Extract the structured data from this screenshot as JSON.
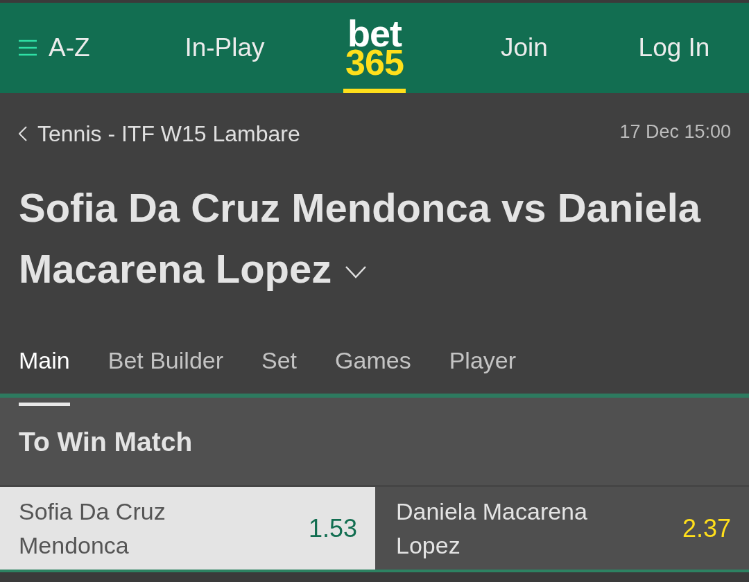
{
  "header": {
    "nav": [
      {
        "kind": "menu",
        "label": "A-Z",
        "selected": false
      },
      {
        "kind": "link",
        "label": "In-Play",
        "selected": false
      },
      {
        "kind": "logo",
        "line_1": "bet",
        "line_2": "365",
        "selected": true
      },
      {
        "kind": "link",
        "label": "Join",
        "selected": false
      },
      {
        "kind": "link",
        "label": "Log In",
        "selected": false
      }
    ]
  },
  "event": {
    "breadcrumb": "Tennis - ITF W15 Lambare",
    "start_time": "17 Dec 15:00",
    "title": "Sofia Da Cruz Mendonca vs Daniela Macarena Lopez"
  },
  "tabs": [
    {
      "label": "Main",
      "selected": true
    },
    {
      "label": "Bet Builder",
      "selected": false
    },
    {
      "label": "Set",
      "selected": false
    },
    {
      "label": "Games",
      "selected": false
    },
    {
      "label": "Player",
      "selected": false
    }
  ],
  "market": {
    "title": "To Win Match",
    "selections": [
      {
        "name": "Sofia Da Cruz Mendonca",
        "odds": "1.53",
        "selected": true
      },
      {
        "name": "Daniela Macarena Lopez",
        "odds": "2.37",
        "selected": false
      }
    ]
  }
}
